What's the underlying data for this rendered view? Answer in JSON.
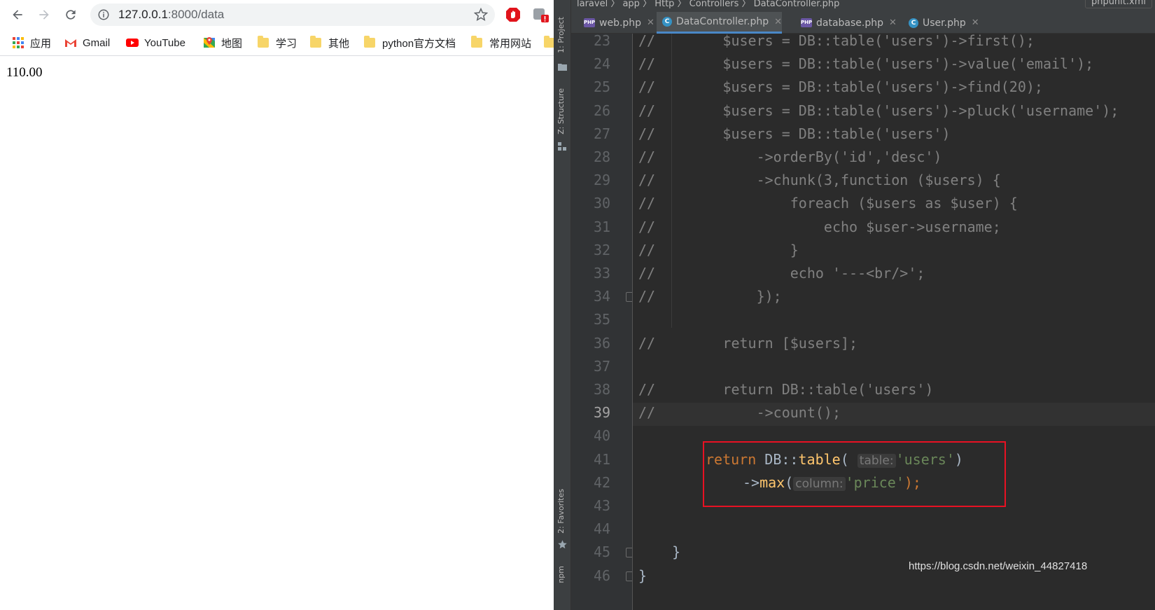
{
  "browser": {
    "url_host": "127.0.0.1",
    "url_path": ":8000/data",
    "bookmarks": [
      {
        "label": "应用",
        "icon": "apps-grid-icon"
      },
      {
        "label": "Gmail",
        "icon": "gmail-icon"
      },
      {
        "label": "YouTube",
        "icon": "youtube-icon"
      },
      {
        "label": "地图",
        "icon": "maps-icon"
      },
      {
        "label": "学习",
        "icon": "folder-icon"
      },
      {
        "label": "其他",
        "icon": "folder-icon"
      },
      {
        "label": "python官方文档",
        "icon": "folder-icon"
      },
      {
        "label": "常用网站",
        "icon": "folder-icon"
      }
    ],
    "page_text": "110.00"
  },
  "ide": {
    "breadcrumb": "laravel 〉 app 〉 Http 〉 Controllers 〉 DataController.php",
    "run_config": "phpunit.xml",
    "tool_windows": {
      "project": "1: Project",
      "structure": "Z: Structure",
      "favorites": "2: Favorites",
      "npm": "npm"
    },
    "tabs": [
      {
        "label": "web.php",
        "icon": "php-file-icon",
        "active": false
      },
      {
        "label": "DataController.php",
        "icon": "class-icon",
        "active": true
      },
      {
        "label": "database.php",
        "icon": "php-file-icon",
        "active": false
      },
      {
        "label": "User.php",
        "icon": "class-icon",
        "active": false
      }
    ],
    "current_line": "39",
    "line_numbers": [
      "23",
      "24",
      "25",
      "26",
      "27",
      "28",
      "29",
      "30",
      "31",
      "32",
      "33",
      "34",
      "35",
      "36",
      "37",
      "38",
      "39",
      "40",
      "41",
      "42",
      "43",
      "44",
      "45",
      "46"
    ],
    "code_lines": [
      "//        $users = DB::table('users')->first();",
      "//        $users = DB::table('users')->value('email');",
      "//        $users = DB::table('users')->find(20);",
      "//        $users = DB::table('users')->pluck('username');",
      "//        $users = DB::table('users')",
      "//            ->orderBy('id','desc')",
      "//            ->chunk(3,function ($users) {",
      "//                foreach ($users as $user) {",
      "//                    echo $user->username;",
      "//                }",
      "//                echo '---<br/>';",
      "//            });",
      "",
      "//        return [$users];",
      "",
      "//        return DB::table('users')",
      "//            ->count();",
      "",
      "",
      "",
      "",
      "",
      "    }",
      "}"
    ],
    "highlight": {
      "kw_return": "return",
      "db_class": "DB",
      "scope_op": "::",
      "fn_table": "table",
      "open_paren": "(",
      "hint_table": "table:",
      "str_users": "'users'",
      "close_paren": ")",
      "arrow": "->",
      "fn_max": "max",
      "hint_column": "column:",
      "str_price": "'price'",
      "semicolon": ");"
    }
  },
  "watermark": "https://blog.csdn.net/weixin_44827418",
  "colors": {
    "ide_bg": "#2b2b2b",
    "comment": "#808080",
    "keyword": "#cc7832",
    "string": "#6a8759",
    "function": "#ffc66d",
    "highlight_box": "#e81123"
  }
}
